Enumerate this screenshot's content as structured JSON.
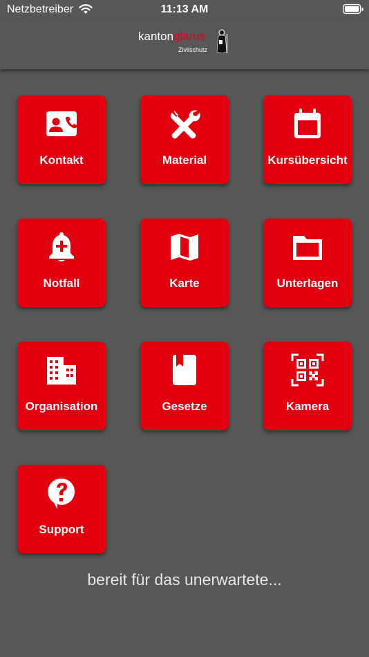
{
  "status_bar": {
    "carrier": "Netzbetreiber",
    "time": "11:13 AM"
  },
  "header": {
    "logo_kanton": "kanton",
    "logo_glarus": "glarus",
    "logo_subtitle": "Zivilschutz"
  },
  "tiles": [
    {
      "label": "Kontakt",
      "icon": "contact-card-icon"
    },
    {
      "label": "Material",
      "icon": "tools-icon"
    },
    {
      "label": "Kursübersicht",
      "icon": "calendar-icon"
    },
    {
      "label": "Notfall",
      "icon": "alarm-bell-icon"
    },
    {
      "label": "Karte",
      "icon": "map-icon"
    },
    {
      "label": "Unterlagen",
      "icon": "folder-icon"
    },
    {
      "label": "Organisation",
      "icon": "building-icon"
    },
    {
      "label": "Gesetze",
      "icon": "book-icon"
    },
    {
      "label": "Kamera",
      "icon": "qr-code-icon"
    },
    {
      "label": "Support",
      "icon": "help-bubble-icon"
    }
  ],
  "tagline": "bereit für das unerwartete...",
  "colors": {
    "background": "#575757",
    "tile": "#e2000f",
    "brand_red": "#e2001a"
  }
}
